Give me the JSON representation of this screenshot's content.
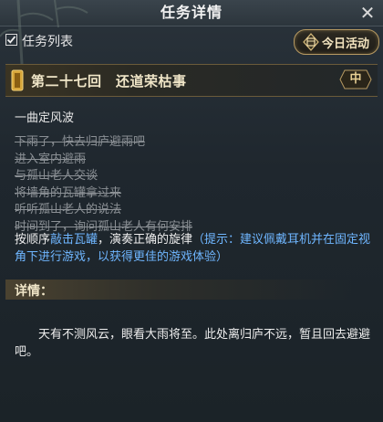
{
  "header": {
    "title": "任务详情",
    "close_glyph": "✕"
  },
  "toolbar": {
    "task_list_label": "任务列表",
    "task_list_checked": true,
    "today_button_label": "今日活动",
    "today_icon": "calendar-icon"
  },
  "chapter": {
    "title": "第二十七回　还道荣枯事",
    "level": "中"
  },
  "quest": {
    "subtitle": "一曲定风波",
    "completed_steps": [
      "下雨了，快去归庐避雨吧",
      "进入室内避雨",
      "与孤山老人交谈",
      "将墙角的瓦罐拿过来",
      "听听孤山老人的说法",
      "时间到了，询问孤山老人有何安排"
    ],
    "current_prefix": "按顺序",
    "current_link": "敲击瓦罐",
    "current_mid": "，演奏正确的旋律",
    "current_hint": "（提示：建议佩戴耳机并在固定视角下进行游戏，以获得更佳的游戏体验）"
  },
  "detail": {
    "label": "详情：",
    "text": "天有不测风云，眼看大雨将至。此处离归庐不远，暂且回去避避吧。"
  },
  "colors": {
    "link": "#6fb6ff",
    "completed_step": "#8b9095",
    "gold": "#e7cf93"
  }
}
